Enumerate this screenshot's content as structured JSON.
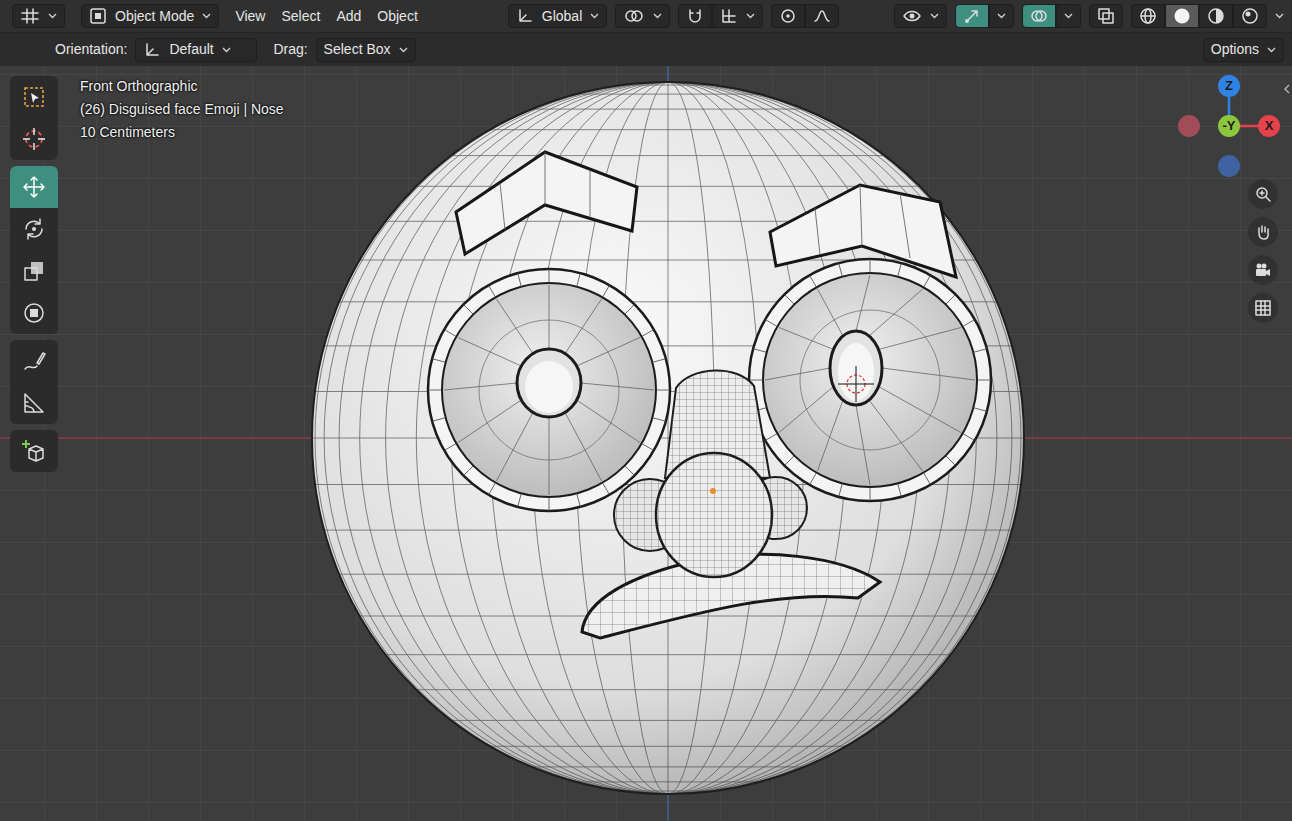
{
  "header": {
    "mode": "Object Mode",
    "menus": [
      "View",
      "Select",
      "Add",
      "Object"
    ],
    "orientation": "Global",
    "snap": {
      "on": false
    },
    "proportional": {
      "on": false
    },
    "gizmos": {
      "on": true
    },
    "overlays": {
      "on": true
    },
    "xray": {
      "on": false
    },
    "shading": [
      {
        "selected": false
      },
      {
        "selected": true
      },
      {
        "selected": false
      },
      {
        "selected": false
      }
    ]
  },
  "tool_settings": {
    "orientation_label": "Orientation:",
    "orientation": "Default",
    "drag_label": "Drag:",
    "drag": "Select Box",
    "options": "Options"
  },
  "toolbar": {
    "groups": [
      [
        {
          "selected": false
        },
        {
          "selected": false
        }
      ],
      [
        {
          "selected": true
        },
        {
          "selected": false
        },
        {
          "selected": false
        },
        {
          "selected": false
        }
      ],
      [
        {
          "selected": false
        },
        {
          "selected": false
        }
      ],
      [
        {
          "selected": false
        }
      ]
    ]
  },
  "viewport": {
    "view": "Front Orthographic",
    "object": "(26) Disguised face Emoji | Nose",
    "scale": "10 Centimeters"
  },
  "gizmo": {
    "axes": [
      {
        "label": "Z",
        "color": "#2f83e4"
      },
      {
        "label": "-Y",
        "color": "#8cc63f"
      },
      {
        "label": "X",
        "color": "#e5424c"
      }
    ],
    "negatives": [
      {
        "color": "#a24c58"
      },
      {
        "color": "#3e63a0"
      }
    ]
  }
}
